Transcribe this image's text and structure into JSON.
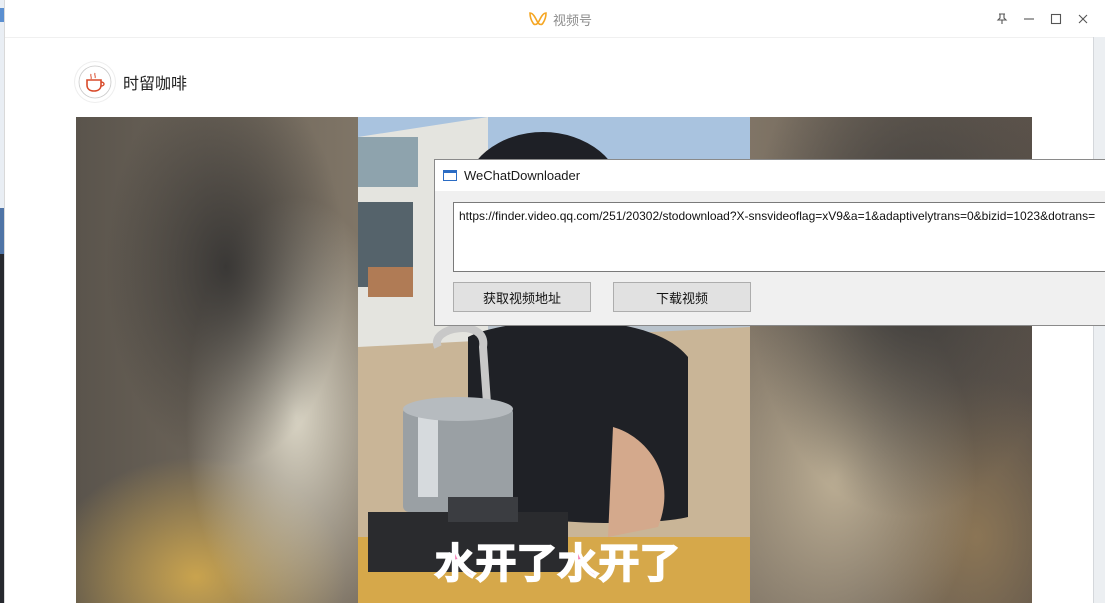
{
  "window": {
    "title": "视频号",
    "controls": [
      "pin-icon",
      "minimize-icon",
      "maximize-icon",
      "close-icon"
    ]
  },
  "channel": {
    "name": "时留咖啡"
  },
  "video": {
    "subtitle": "水开了水开了"
  },
  "dialog": {
    "title": "WeChatDownloader",
    "url_value": "https://finder.video.qq.com/251/20302/stodownload?X-snsvideoflag=xV9&a=1&adaptivelytrans=0&bizid=1023&dotrans=",
    "get_address_button": "获取视频地址",
    "download_button": "下载视频"
  },
  "colors": {
    "logo_accent": "#f5a623",
    "subtitle_fill": "#f47fb6",
    "dialog_icon": "#2b6cc4"
  }
}
